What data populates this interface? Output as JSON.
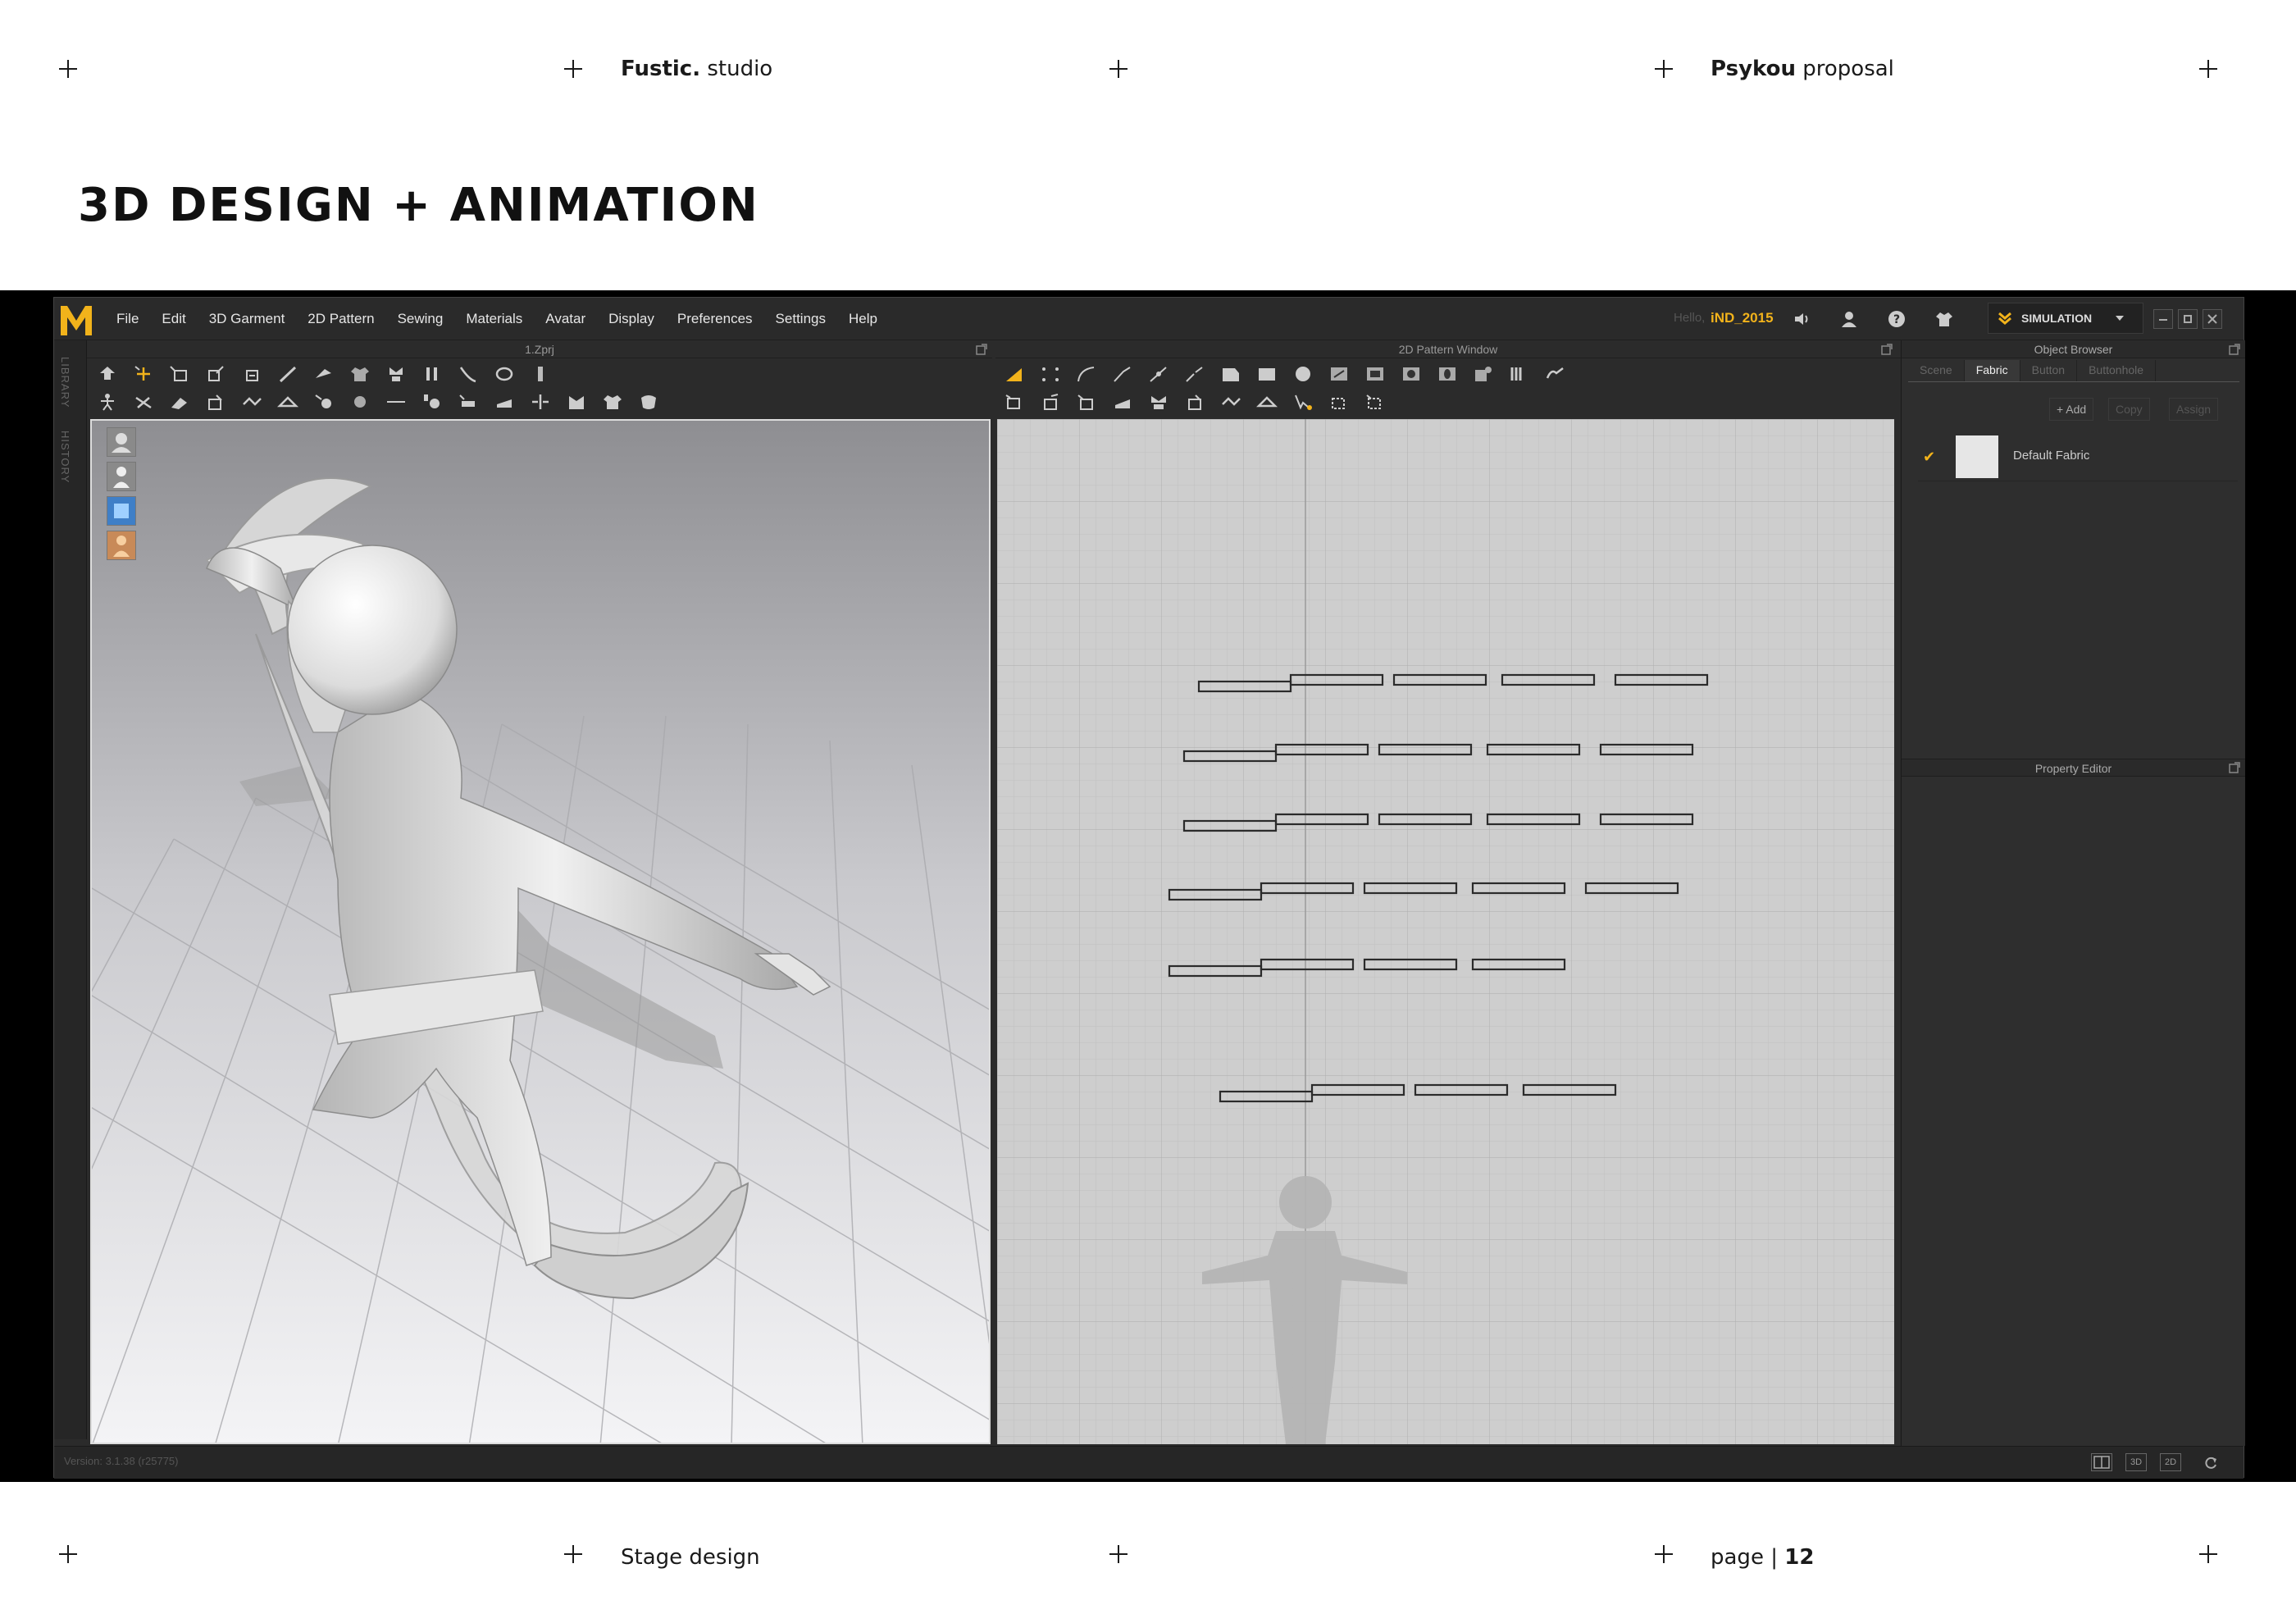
{
  "header": {
    "studio_bold": "Fustic.",
    "studio_rest": " studio",
    "proposal_bold": "Psykou",
    "proposal_rest": " proposal"
  },
  "title": "3D DESIGN + ANIMATION",
  "footer": {
    "section": "Stage design",
    "page_label": "page | ",
    "page_number": "12"
  },
  "app": {
    "logo": "M",
    "menu": [
      "File",
      "Edit",
      "3D Garment",
      "2D Pattern",
      "Sewing",
      "Materials",
      "Avatar",
      "Display",
      "Preferences",
      "Settings",
      "Help"
    ],
    "hello": "Hello,",
    "user": "iND_2015",
    "mode": "SIMULATION",
    "left_strip": [
      "LIBRARY",
      "HISTORY"
    ],
    "panel3d_title": "1.Zprj",
    "panel2d_title": "2D Pattern Window",
    "object_browser": {
      "title": "Object Browser",
      "tabs": [
        "Scene",
        "Fabric",
        "Button",
        "Buttonhole"
      ],
      "active_tab": "Fabric",
      "buttons": [
        "+ Add",
        "Copy",
        "Assign"
      ],
      "fabric_item": "Default Fabric"
    },
    "property_editor_title": "Property Editor",
    "version": "Version: 3.1.38 (r25775)",
    "status_buttons": [
      "3D",
      "2D"
    ],
    "accent_color": "#f2b31b"
  }
}
